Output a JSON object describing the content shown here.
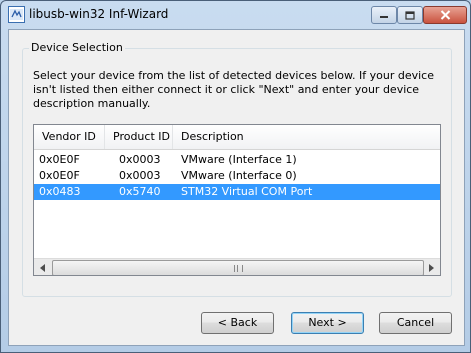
{
  "window": {
    "title": "libusb-win32 Inf-Wizard"
  },
  "group": {
    "label": "Device Selection"
  },
  "instructions": "Select your device from the list of detected devices below. If your device isn't listed then either connect it or click \"Next\" and enter your device description manually.",
  "device_list": {
    "columns": [
      "Vendor ID",
      "Product ID",
      "Description"
    ],
    "rows": [
      {
        "vendor_id": "0x0E0F",
        "product_id": "0x0003",
        "description": "VMware (Interface 1)",
        "selected": false
      },
      {
        "vendor_id": "0x0E0F",
        "product_id": "0x0003",
        "description": "VMware (Interface 0)",
        "selected": false
      },
      {
        "vendor_id": "0x0483",
        "product_id": "0x5740",
        "description": "STM32 Virtual COM Port",
        "selected": true
      }
    ]
  },
  "buttons": {
    "back": "< Back",
    "next": "Next >",
    "cancel": "Cancel"
  },
  "colors": {
    "selection": "#3399ff",
    "titlebar": "#c9dcf0",
    "close_button": "#c9533f"
  }
}
